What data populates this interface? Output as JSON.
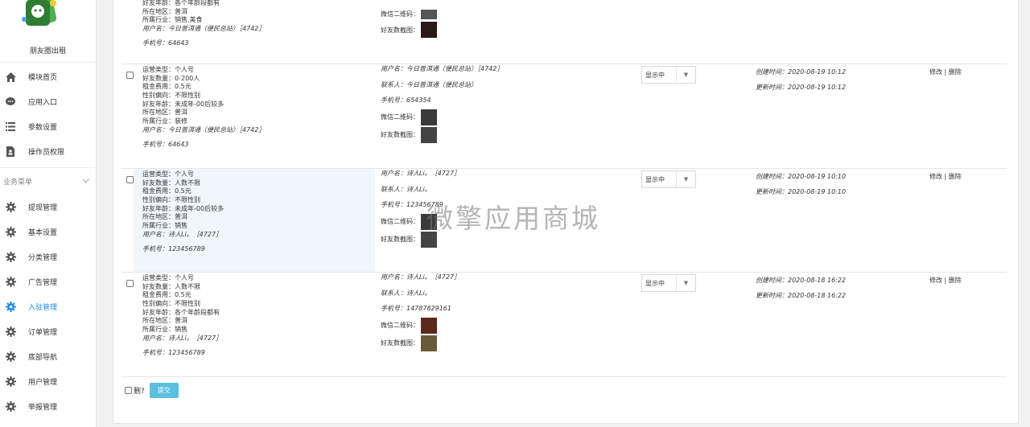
{
  "brand": {
    "name": "朋友圈出租"
  },
  "sidebar": {
    "items": [
      {
        "label": "模块首页",
        "icon": "home-icon"
      },
      {
        "label": "应用入口",
        "icon": "chat-icon"
      },
      {
        "label": "参数设置",
        "icon": "list-icon"
      },
      {
        "label": "操作员权限",
        "icon": "user-doc-icon"
      }
    ],
    "section_title": "业务菜单",
    "business_items": [
      {
        "label": "提现管理",
        "icon": "gear-icon"
      },
      {
        "label": "基本设置",
        "icon": "gear-icon"
      },
      {
        "label": "分类管理",
        "icon": "gear-icon"
      },
      {
        "label": "广告管理",
        "icon": "gear-icon"
      },
      {
        "label": "入驻管理",
        "icon": "gear-icon",
        "active": true
      },
      {
        "label": "订单管理",
        "icon": "gear-icon"
      },
      {
        "label": "底部导航",
        "icon": "gear-icon"
      },
      {
        "label": "用户管理",
        "icon": "gear-icon"
      },
      {
        "label": "举报管理",
        "icon": "gear-icon"
      }
    ]
  },
  "row0": {
    "friend_age": "好友年龄：各个年龄段都有",
    "region": "所在地区：普洱",
    "industry": "所属行业：销售,美食",
    "username": "用户名：今日普洱通（便民总站）［4742］",
    "phone": "手机号：64643",
    "wechat_qr": "微信二维码：",
    "friend_shot": "好友数截图："
  },
  "rows": [
    {
      "type": "运营类型：个人号",
      "friends": "好友数量：0-200人",
      "rent": "租金费用：0.5元",
      "gender": "性别偏向：不限性别",
      "friend_age": "好友年龄：未成年-00后较多",
      "region": "所在地区：普洱",
      "industry": "所属行业：装修",
      "username": "用户名：今日普洱通（便民总站）［4742］",
      "phone": "手机号：64643",
      "c2_username": "用户名：今日普洱通（便民总站）［4742］",
      "c2_contact": "联系人：今日普洱通（便民总站）",
      "c2_phone": "手机号：654354",
      "wechat_qr": "微信二维码：",
      "friend_shot": "好友数截图：",
      "status": "显示中",
      "created": "创建时间：2020-08-19 10:12",
      "updated": "更新时间：2020-08-19 10:12",
      "edit": "修改",
      "sep": "|",
      "del": "删除"
    },
    {
      "type": "运营类型：个人号",
      "friends": "好友数量：人数不限",
      "rent": "租金费用：0.5元",
      "gender": "性别偏向：不限性别",
      "friend_age": "好友年龄：未成年-00后较多",
      "region": "所在地区：普洱",
      "industry": "所属行业：销售",
      "username": "用户名：诗人Li。［4727］",
      "phone": "手机号：123456789",
      "c2_username": "用户名：诗人Li。［4727］",
      "c2_contact": "联系人：诗人Li。",
      "c2_phone": "手机号：123456789",
      "wechat_qr": "微信二维码：",
      "friend_shot": "好友数截图：",
      "status": "显示中",
      "created": "创建时间：2020-08-19 10:10",
      "updated": "更新时间：2020-08-19 10:10",
      "edit": "修改",
      "sep": "|",
      "del": "删除"
    },
    {
      "type": "运营类型：个人号",
      "friends": "好友数量：人数不限",
      "rent": "租金费用：0.5元",
      "gender": "性别偏向：不限性别",
      "friend_age": "好友年龄：各个年龄段都有",
      "region": "所在地区：普洱",
      "industry": "所属行业：销售",
      "username": "用户名：诗人Li。［4727］",
      "phone": "手机号：123456789",
      "c2_username": "用户名：诗人Li。［4727］",
      "c2_contact": "联系人：诗人Li。",
      "c2_phone": "手机号：14787829161",
      "wechat_qr": "微信二维码：",
      "friend_shot": "好友数截图：",
      "status": "显示中",
      "created": "创建时间：2020-08-18 16:22",
      "updated": "更新时间：2020-08-18 16:22",
      "edit": "修改",
      "sep": "|",
      "del": "删除"
    }
  ],
  "bottom": {
    "delete_label": "删?",
    "submit_label": "提交"
  },
  "watermark": "微擎应用商城",
  "colors": {
    "accent": "#1e88e5",
    "submit": "#5bc0de"
  }
}
